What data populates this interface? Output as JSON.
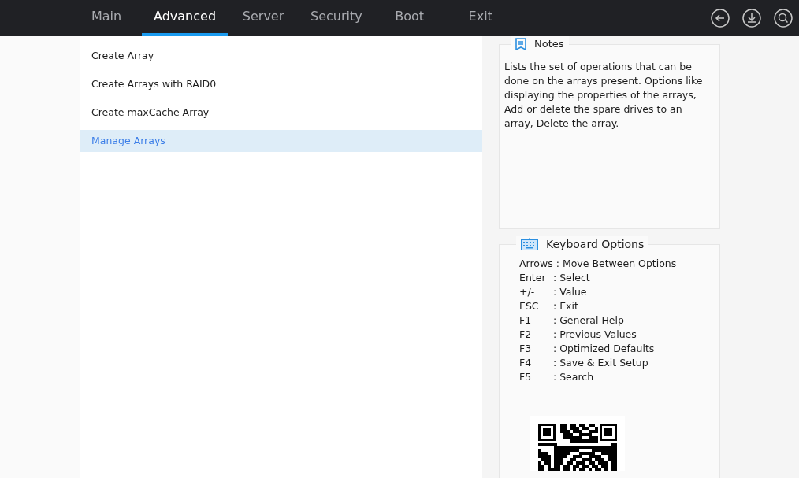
{
  "tabs": [
    {
      "label": "Main",
      "selected": false
    },
    {
      "label": "Advanced",
      "selected": true
    },
    {
      "label": "Server",
      "selected": false
    },
    {
      "label": "Security",
      "selected": false
    },
    {
      "label": "Boot",
      "selected": false
    },
    {
      "label": "Exit",
      "selected": false
    }
  ],
  "menu_items": [
    {
      "label": "Create Array",
      "selected": false
    },
    {
      "label": "Create Arrays with RAID0",
      "selected": false
    },
    {
      "label": "Create maxCache Array",
      "selected": false
    },
    {
      "label": "Manage Arrays",
      "selected": true
    }
  ],
  "notes": {
    "title": "Notes",
    "text": "Lists the set of operations that can be done on the arrays present. Options like displaying the properties of the arrays, Add or delete the spare drives to an array, Delete the array."
  },
  "keyboard_options": {
    "title": "Keyboard Options",
    "rows": [
      {
        "key": "Arrows",
        "description": ": Move Between Options"
      },
      {
        "key": "Enter",
        "description": ": Select"
      },
      {
        "key": "+/-",
        "description": ": Value"
      },
      {
        "key": "ESC",
        "description": ": Exit"
      },
      {
        "key": "F1",
        "description": ": General Help"
      },
      {
        "key": "F2",
        "description": ": Previous Values"
      },
      {
        "key": "F3",
        "description": ": Optimized Defaults"
      },
      {
        "key": "F4",
        "description": ": Save & Exit Setup"
      },
      {
        "key": "F5",
        "description": ": Search"
      }
    ]
  }
}
